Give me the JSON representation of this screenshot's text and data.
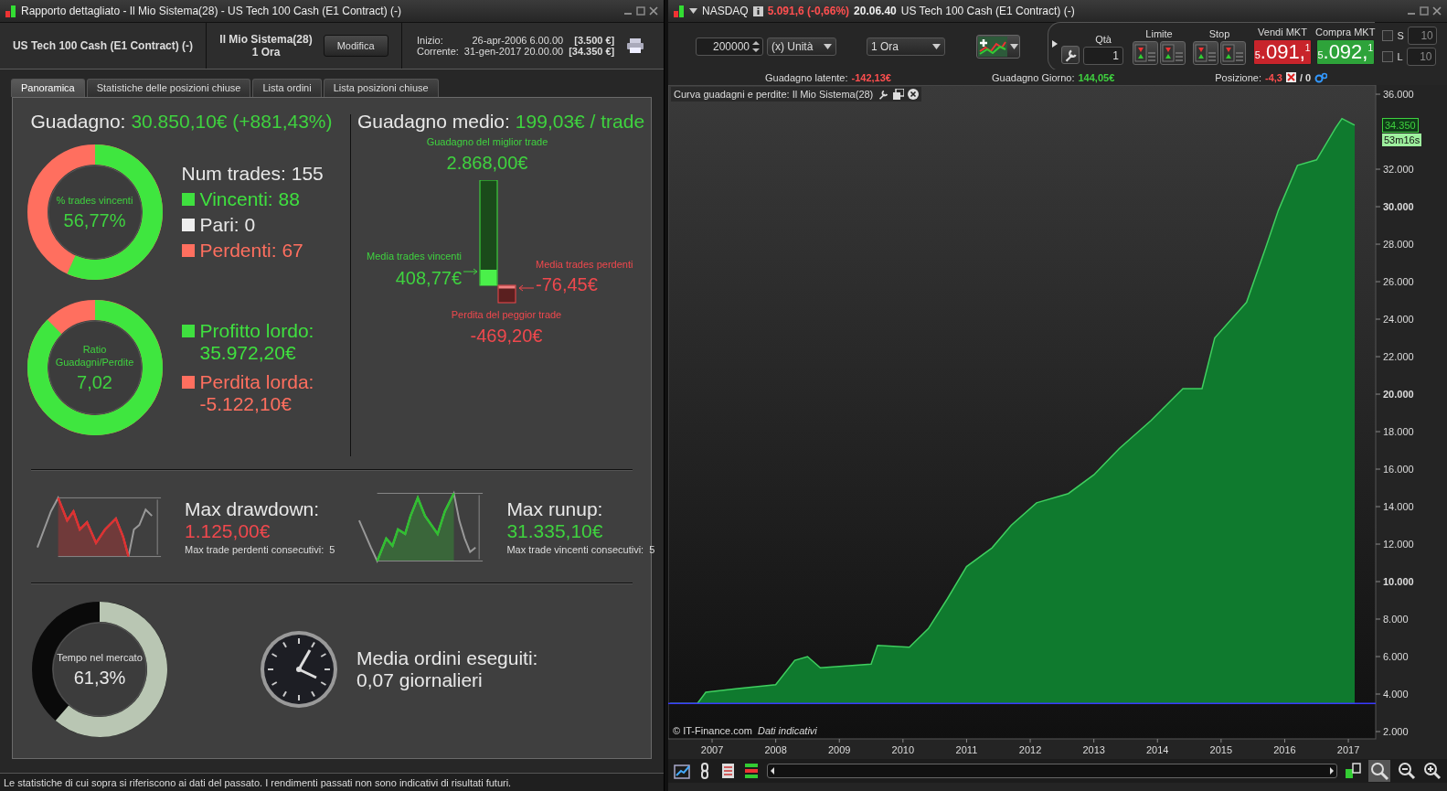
{
  "left_window": {
    "title": "Rapporto dettagliato - Il Mio Sistema(28) - US Tech 100 Cash (E1 Contract) (-)",
    "instrument": "US Tech 100 Cash (E1 Contract) (-)",
    "system_name": "Il Mio Sistema(28)",
    "timeframe": "1 Ora",
    "modify_button": "Modifica",
    "period": [
      {
        "label": "Inizio:",
        "date": "26-apr-2006 6.00.00",
        "capital": "[3.500 €]"
      },
      {
        "label": "Corrente:",
        "date": "31-gen-2017 20.00.00",
        "capital": "[34.350 €]"
      }
    ],
    "tabs": [
      {
        "label": "Panoramica",
        "selected": true
      },
      {
        "label": "Statistiche delle posizioni chiuse",
        "selected": false
      },
      {
        "label": "Lista ordini",
        "selected": false
      },
      {
        "label": "Lista posizioni chiuse",
        "selected": false
      }
    ],
    "gain": {
      "label": "Guadagno:",
      "value": "30.850,10€ (+881,43%)"
    },
    "win_ring": {
      "caption": "% trades vincenti",
      "value": "56,77%"
    },
    "trades": {
      "total": "Num trades: 155",
      "items": [
        {
          "label": "Vincenti: 88",
          "color": "#3fe03f"
        },
        {
          "label": "Pari: 0",
          "color": "#eeeeee"
        },
        {
          "label": "Perdenti: 67",
          "color": "#ff6f5f"
        }
      ]
    },
    "ratio_ring": {
      "caption": "Ratio Guadagni/Perdite",
      "value": "7,02"
    },
    "gross": [
      {
        "label": "Profitto lordo:",
        "value": "35.972,20€",
        "color": "#3fe03f"
      },
      {
        "label": "Perdita lorda:",
        "value": "-5.122,10€",
        "color": "#ff6f5f"
      }
    ],
    "avg_gain": {
      "label": "Guadagno medio:",
      "value": "199,03€ / trade"
    },
    "trade_bars": {
      "best": {
        "label": "Guadagno del miglior trade",
        "value": "2.868,00€"
      },
      "avg_win": {
        "label": "Media trades vincenti",
        "value": "408,77€"
      },
      "avg_loss": {
        "label": "Media trades perdenti",
        "value": "-76,45€"
      },
      "worst": {
        "label": "Perdita del peggior trade",
        "value": "-469,20€"
      }
    },
    "drawdown": {
      "title": "Max drawdown:",
      "value": "1.125,00€",
      "streak_label": "Max trade perdenti consecutivi:",
      "streak": "5"
    },
    "runup": {
      "title": "Max runup:",
      "value": "31.335,10€",
      "streak_label": "Max trade vincenti consecutivi:",
      "streak": "5"
    },
    "time_ring": {
      "caption": "Tempo nel mercato",
      "value": "61,3%"
    },
    "orders": {
      "title": "Media ordini eseguiti:",
      "value": "0,07 giornalieri"
    },
    "status_bar": "Le statistiche di cui sopra si riferiscono ai dati del passato. I rendimenti passati non sono indicativi di risultati futuri."
  },
  "right_window": {
    "symbol": "NASDAQ",
    "quote": "5.091,6 (-0,66%)",
    "time": "20.06.40",
    "title": "US Tech 100 Cash (E1 Contract) (-)",
    "quantity": "200000",
    "unit": "(x) Unità",
    "timeframe": "1 Ora",
    "order_panel": {
      "qty_label": "Qtà",
      "qty": "1",
      "limit_label": "Limite",
      "stop_label": "Stop",
      "sell": {
        "label": "Vendi MKT",
        "prefix": "5",
        "main": ".091,",
        "sup": "1"
      },
      "buy": {
        "label": "Compra MKT",
        "prefix": "5",
        "main": ".092,",
        "sup": "1"
      }
    },
    "toggles": [
      {
        "label": "S",
        "checked": false,
        "value": "10"
      },
      {
        "label": "L",
        "checked": false,
        "value": "10"
      }
    ],
    "stats": [
      {
        "label": "Guadagno latente:",
        "value": "-142,13€",
        "color": "#ff4f4f"
      },
      {
        "label": "Guadagno Giorno:",
        "value": "144,05€",
        "color": "#3fcf3f"
      },
      {
        "label": "Posizione:",
        "value": "-4,3",
        "color": "#ff4f4f",
        "suffix": "/ 0"
      }
    ],
    "chart": {
      "last_value": "34.350",
      "countdown": "53m16s",
      "credit": "© IT-Finance.com",
      "note": "Dati indicativi",
      "chart_data": {
        "type": "area",
        "title": "Curva guadagni e perdite: Il Mio Sistema(28)",
        "x": [
          2006.34,
          2006.77,
          2006.9,
          2007.4,
          2008.0,
          2008.3,
          2008.5,
          2008.7,
          2009.5,
          2009.6,
          2010.1,
          2010.4,
          2010.7,
          2011.0,
          2011.4,
          2011.7,
          2012.1,
          2012.6,
          2013.0,
          2013.4,
          2013.9,
          2014.4,
          2014.7,
          2014.9,
          2015.4,
          2015.7,
          2015.9,
          2016.2,
          2016.5,
          2016.8,
          2016.9,
          2017.1
        ],
        "series": [
          {
            "color": "#0f7a2e",
            "values": [
              3500,
              3500,
              4100,
              4300,
              4500,
              5800,
              6000,
              5400,
              5600,
              6600,
              6500,
              7500,
              9100,
              10800,
              11800,
              13000,
              14200,
              14700,
              15700,
              17100,
              18600,
              20300,
              20300,
              23000,
              24900,
              27800,
              29800,
              32200,
              32500,
              34200,
              34700,
              34350
            ]
          }
        ],
        "xlim": [
          2006.31,
          2017.43
        ],
        "ylim": [
          1610,
          36490
        ],
        "xticks": [
          {
            "value": 2007,
            "label": "2007"
          },
          {
            "value": 2008,
            "label": "2008"
          },
          {
            "value": 2009,
            "label": "2009"
          },
          {
            "value": 2010,
            "label": "2010"
          },
          {
            "value": 2011,
            "label": "2011"
          },
          {
            "value": 2012,
            "label": "2012"
          },
          {
            "value": 2013,
            "label": "2013"
          },
          {
            "value": 2014,
            "label": "2014"
          },
          {
            "value": 2015,
            "label": "2015"
          },
          {
            "value": 2016,
            "label": "2016"
          },
          {
            "value": 2017,
            "label": "2017"
          }
        ],
        "yticks": [
          {
            "value": 2000,
            "label": "2.000"
          },
          {
            "value": 4000,
            "label": "4.000"
          },
          {
            "value": 6000,
            "label": "6.000"
          },
          {
            "value": 8000,
            "label": "8.000"
          },
          {
            "value": 10000,
            "label": "10.000"
          },
          {
            "value": 12000,
            "label": "12.000"
          },
          {
            "value": 14000,
            "label": "14.000"
          },
          {
            "value": 16000,
            "label": "16.000"
          },
          {
            "value": 18000,
            "label": "18.000"
          },
          {
            "value": 20000,
            "label": "20.000"
          },
          {
            "value": 22000,
            "label": "22.000"
          },
          {
            "value": 24000,
            "label": "24.000"
          },
          {
            "value": 26000,
            "label": "26.000"
          },
          {
            "value": 28000,
            "label": "28.000"
          },
          {
            "value": 30000,
            "label": "30.000"
          },
          {
            "value": 32000,
            "label": "32.000"
          },
          {
            "value": 36000,
            "label": "36.000"
          }
        ],
        "ref_lines": [
          {
            "axis": "y",
            "value": 3500,
            "color": "#3a3aff"
          }
        ]
      }
    }
  }
}
